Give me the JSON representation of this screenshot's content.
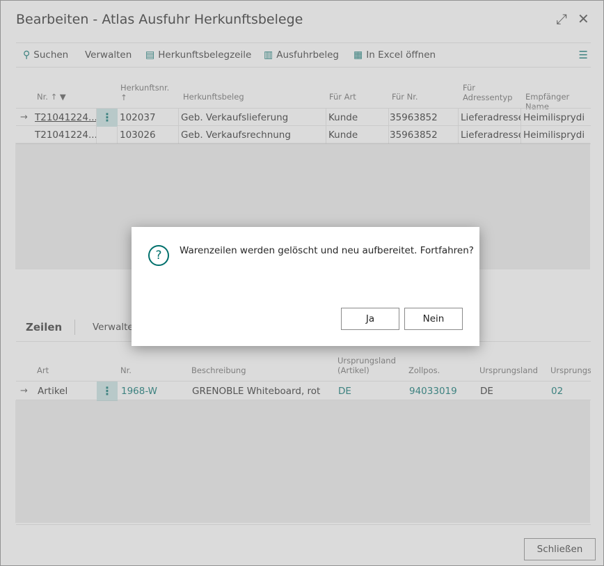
{
  "window": {
    "title": "Bearbeiten - Atlas Ausfuhr Herkunftsbelege",
    "expand_icon": "⤢",
    "close_icon": "✕"
  },
  "toolbar": {
    "search_label": "Suchen",
    "manage_label": "Verwalten",
    "source_line_label": "Herkunftsbelegzeile",
    "export_doc_label": "Ausfuhrbeleg",
    "excel_label": "In Excel öffnen"
  },
  "header": {
    "columns": {
      "nr": "Nr. ↑",
      "source_nr_line1": "Herkunftsnr.",
      "source_nr_line2": "↑",
      "source_doc": "Herkunftsbeleg",
      "for_type": "Für Art",
      "for_nr": "Für Nr.",
      "addr_type_line1": "Für",
      "addr_type_line2": "Adressentyp",
      "recipient": "Empfänger Name"
    },
    "rows": [
      {
        "nr": "T21041224...",
        "source_nr": "102037",
        "source_doc": "Geb. Verkaufslieferung",
        "for_type": "Kunde",
        "for_nr": "35963852",
        "addr_type": "Lieferadresse",
        "recipient": "Heimilisprydi"
      },
      {
        "nr": "T21041224...",
        "source_nr": "103026",
        "source_doc": "Geb. Verkaufsrechnung",
        "for_type": "Kunde",
        "for_nr": "35963852",
        "addr_type": "Lieferadresse",
        "recipient": "Heimilisprydi"
      }
    ]
  },
  "lines": {
    "title": "Zeilen",
    "manage_label": "Verwalten",
    "columns": {
      "type": "Art",
      "nr": "Nr.",
      "description": "Beschreibung",
      "origin_item_line1": "Ursprungsland",
      "origin_item_line2": "(Artikel)",
      "tariff": "Zollpos.",
      "origin_country": "Ursprungsland",
      "origin_region": "Ursprungsre"
    },
    "rows": [
      {
        "type": "Artikel",
        "nr": "1968-W",
        "description": "GRENOBLE Whiteboard, rot",
        "origin_item": "DE",
        "tariff": "94033019",
        "origin_country": "DE",
        "origin_region": "02"
      }
    ]
  },
  "footer": {
    "close_label": "Schließen"
  },
  "dialog": {
    "icon": "?",
    "message": "Warenzeilen werden gelöscht und neu aufbereitet. Fortfahren?",
    "yes_label": "Ja",
    "no_label": "Nein"
  }
}
